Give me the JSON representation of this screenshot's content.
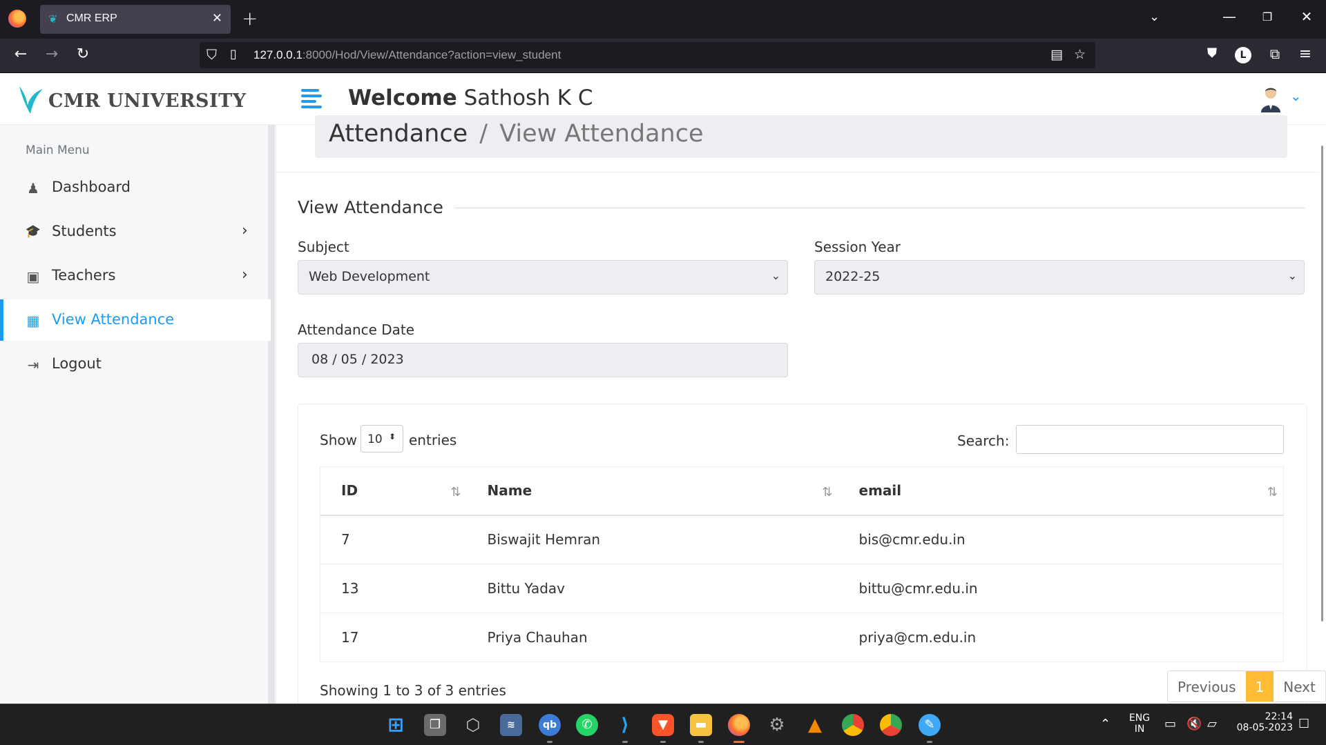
{
  "browser": {
    "tab_title": "CMR ERP",
    "url_host": "127.0.0.1",
    "url_rest": ":8000/Hod/View/Attendance?action=view_student",
    "profile_initial": "L"
  },
  "brand": {
    "name": "CMR UNIVERSITY",
    "accent": "#1b9cf2"
  },
  "sidebar": {
    "title": "Main Menu",
    "items": [
      {
        "label": "Dashboard",
        "icon": "user-tie-icon",
        "glyph": "♟",
        "has_arrow": false,
        "active": false
      },
      {
        "label": "Students",
        "icon": "graduate-icon",
        "glyph": "🎓",
        "has_arrow": true,
        "active": false
      },
      {
        "label": "Teachers",
        "icon": "chalkboard-teacher-icon",
        "glyph": "▣",
        "has_arrow": true,
        "active": false
      },
      {
        "label": "View Attendance",
        "icon": "calendar-icon",
        "glyph": "▦",
        "has_arrow": false,
        "active": true
      },
      {
        "label": "Logout",
        "icon": "sign-out-icon",
        "glyph": "⇥",
        "has_arrow": false,
        "active": false
      }
    ]
  },
  "header": {
    "welcome_prefix": "Welcome",
    "user_name": "Sathosh K C"
  },
  "breadcrumb": {
    "parent": "Attendance",
    "separator": "/",
    "current": "View Attendance"
  },
  "form": {
    "title": "View Attendance",
    "subject_label": "Subject",
    "subject_value": "Web Development",
    "session_label": "Session Year",
    "session_value": "2022-25",
    "date_label": "Attendance Date",
    "date_value": "08 / 05 / 2023"
  },
  "table": {
    "show_label": "Show",
    "length_value": "10",
    "entries_label": "entries",
    "search_label": "Search:",
    "search_value": "",
    "columns": [
      "ID",
      "Name",
      "email"
    ],
    "rows": [
      [
        "7",
        "Biswajit Hemran",
        "bis@cmr.edu.in"
      ],
      [
        "13",
        "Bittu Yadav",
        "bittu@cmr.edu.in"
      ],
      [
        "17",
        "Priya Chauhan",
        "priya@cm.edu.in"
      ]
    ],
    "info": "Showing 1 to 3 of 3 entries",
    "pager": {
      "previous": "Previous",
      "current": "1",
      "next": "Next"
    },
    "pager_color": "#ffbc34"
  },
  "taskbar": {
    "lang_line1": "ENG",
    "lang_line2": "IN",
    "time": "22:14",
    "date": "08-05-2023"
  }
}
